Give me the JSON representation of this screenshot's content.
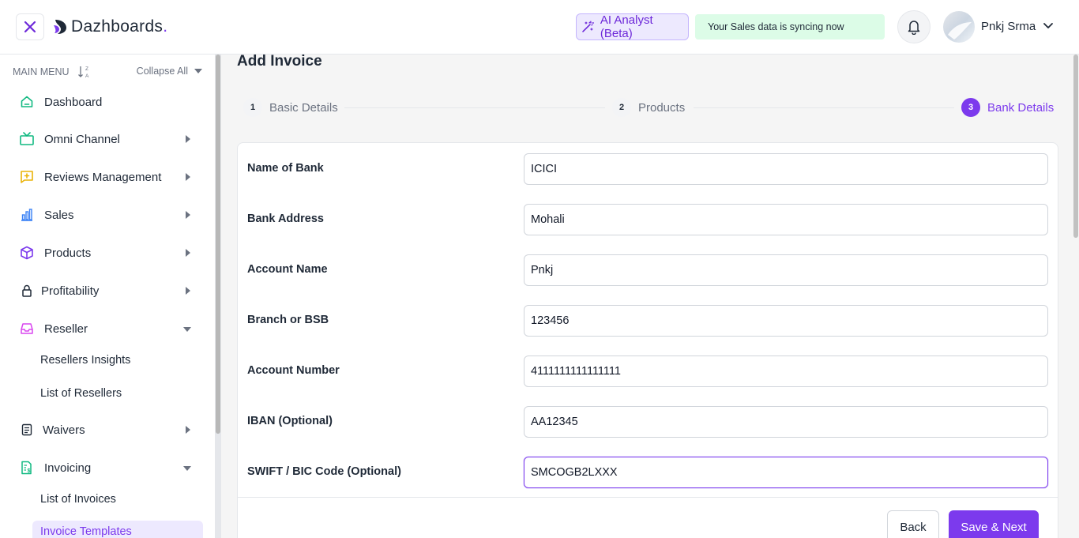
{
  "header": {
    "brand": "Dazhboards",
    "brand_dot": ".",
    "ai_button_label": "AI Analyst (Beta)",
    "sync_message": "Your Sales data is syncing now",
    "user_name": "Pnkj Srma",
    "icons": {
      "close": "close-icon",
      "logo": "logo-icon",
      "ai": "magic-wand-icon",
      "bell": "bell-icon",
      "chevron": "chevron-down-icon"
    }
  },
  "sidebar": {
    "main_menu_label": "MAIN MENU",
    "collapse_label": "Collapse All",
    "items": [
      {
        "label": "Dashboard",
        "icon": "home-icon",
        "color": "#10b981"
      },
      {
        "label": "Omni Channel",
        "icon": "tv-icon",
        "color": "#10b981"
      },
      {
        "label": "Reviews Management",
        "icon": "message-plus-icon",
        "color": "#eab308"
      },
      {
        "label": "Sales",
        "icon": "bar-chart-icon",
        "color": "#3b82f6"
      },
      {
        "label": "Products",
        "icon": "box-icon",
        "color": "#7c3aed"
      },
      {
        "label": "Profitability",
        "icon": "lock-icon",
        "color": "#1f2937"
      },
      {
        "label": "Reseller",
        "icon": "inbox-icon",
        "color": "#d946ef"
      },
      {
        "label": "Waivers",
        "icon": "document-icon",
        "color": "#1f2937"
      },
      {
        "label": "Invoicing",
        "icon": "invoice-icon",
        "color": "#10b981"
      }
    ],
    "reseller_sub": [
      "Resellers Insights",
      "List of Resellers"
    ],
    "invoicing_sub": [
      "List of Invoices",
      "Invoice Templates"
    ]
  },
  "page": {
    "title": "Add Invoice",
    "steps": [
      {
        "num": "1",
        "label": "Basic Details"
      },
      {
        "num": "2",
        "label": "Products"
      },
      {
        "num": "3",
        "label": "Bank Details"
      }
    ],
    "active_step": "3",
    "fields": [
      {
        "label": "Name of Bank",
        "value": "ICICI"
      },
      {
        "label": "Bank Address",
        "value": "Mohali"
      },
      {
        "label": "Account Name",
        "value": "Pnkj"
      },
      {
        "label": "Branch or BSB",
        "value": "123456"
      },
      {
        "label": "Account Number",
        "value": "4111111111111111"
      },
      {
        "label": "IBAN (Optional)",
        "value": "AA12345"
      },
      {
        "label": "SWIFT / BIC Code (Optional)",
        "value": "SMCOGB2LXXX"
      }
    ],
    "back_label": "Back",
    "save_label": "Save & Next"
  },
  "colors": {
    "accent": "#7c3aed",
    "sync_bg": "#dcfce7"
  }
}
